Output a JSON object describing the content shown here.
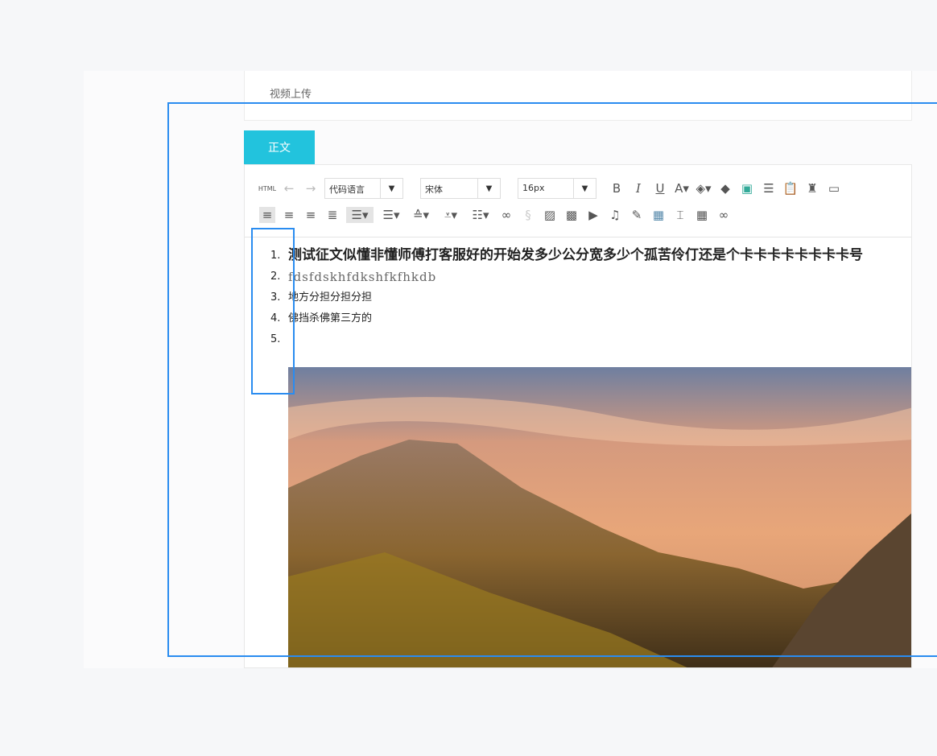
{
  "upload": {
    "video_label": "视频上传"
  },
  "tab": {
    "label": "正文"
  },
  "toolbar": {
    "html_label": "HTML",
    "code_language": "代码语言",
    "font_family": "宋体",
    "font_size": "16px"
  },
  "content": {
    "items": [
      {
        "num": "1.",
        "text": "测试征文似懂非懂师傅打客服好的开始发多少公分宽多少个孤苦伶仃还是个卡卡卡卡卡卡卡卡号"
      },
      {
        "num": "2.",
        "text": "fdsfdskhfdkshfkfhkdb"
      },
      {
        "num": "3.",
        "text": "地方分担分担分担"
      },
      {
        "num": "4.",
        "text": "佛挡杀佛第三方的"
      },
      {
        "num": "5.",
        "text": ""
      }
    ]
  },
  "colors": {
    "accent": "#22c3dd",
    "selection": "#2a8cf0"
  }
}
